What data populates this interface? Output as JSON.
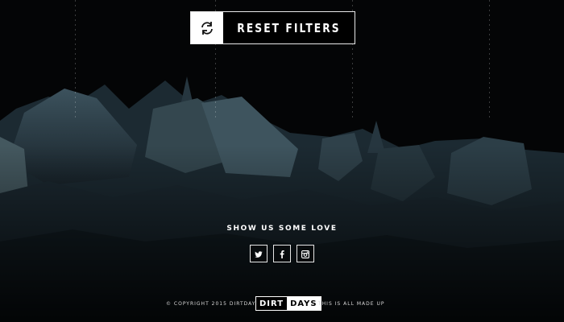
{
  "reset": {
    "label": "RESET FILTERS",
    "icon": "refresh-icon"
  },
  "social": {
    "title": "SHOW US SOME LOVE",
    "links": [
      {
        "name": "twitter",
        "icon": "twitter-icon"
      },
      {
        "name": "facebook",
        "icon": "facebook-icon"
      },
      {
        "name": "instagram",
        "icon": "instagram-icon"
      }
    ]
  },
  "footer": {
    "copyright": "© COPYRIGHT 2015 DIRTDAYS",
    "logo_part1": "DIRT",
    "logo_part2": "DAYS",
    "tagline": "THIS IS ALL MADE UP"
  },
  "colors": {
    "background": "#050607",
    "rock": "#2f434d",
    "text": "#ffffff"
  }
}
